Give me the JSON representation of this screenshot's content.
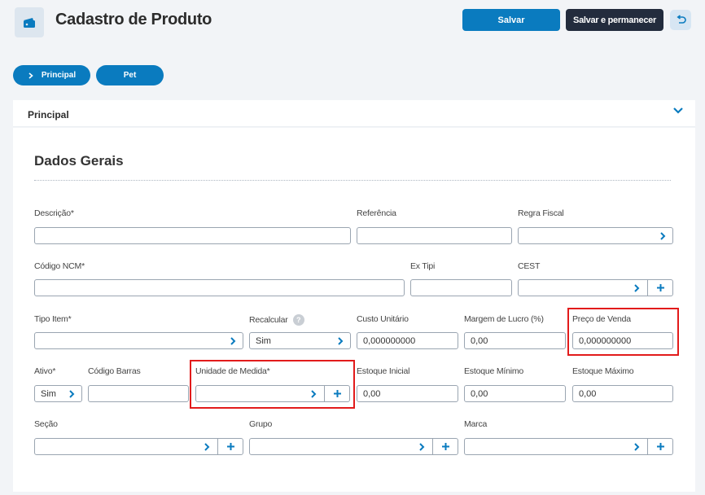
{
  "header": {
    "title": "Cadastro de Produto",
    "save_label": "Salvar",
    "save_stay_label": "Salvar e permanecer",
    "icon": "wallet-icon",
    "back_icon": "undo-icon"
  },
  "tabs": [
    {
      "label": "Principal",
      "active": true
    },
    {
      "label": "Pet",
      "active": false
    }
  ],
  "section": {
    "label": "Principal",
    "title": "Dados Gerais"
  },
  "fields": {
    "descricao": {
      "label": "Descrição*",
      "value": ""
    },
    "referencia": {
      "label": "Referência",
      "value": ""
    },
    "regra_fiscal": {
      "label": "Regra Fiscal",
      "value": ""
    },
    "codigo_ncm": {
      "label": "Código NCM*",
      "value": ""
    },
    "ex_tipi": {
      "label": "Ex Tipi",
      "value": ""
    },
    "cest": {
      "label": "CEST",
      "value": ""
    },
    "tipo_item": {
      "label": "Tipo Item*",
      "value": ""
    },
    "recalcular": {
      "label": "Recalcular",
      "value": "Sim"
    },
    "custo_unitario": {
      "label": "Custo Unitário",
      "value": "0,000000000"
    },
    "margem_lucro": {
      "label": "Margem de Lucro (%)",
      "value": "0,00"
    },
    "preco_venda": {
      "label": "Preço de Venda",
      "value": "0,000000000"
    },
    "ativo": {
      "label": "Ativo*",
      "value": "Sim"
    },
    "codigo_barras": {
      "label": "Código Barras",
      "value": ""
    },
    "unidade_medida": {
      "label": "Unidade de Medida*",
      "value": ""
    },
    "estoque_inicial": {
      "label": "Estoque Inicial",
      "value": "0,00"
    },
    "estoque_minimo": {
      "label": "Estoque Mínimo",
      "value": "0,00"
    },
    "estoque_maximo": {
      "label": "Estoque Máximo",
      "value": "0,00"
    },
    "secao": {
      "label": "Seção",
      "value": ""
    },
    "grupo": {
      "label": "Grupo",
      "value": ""
    },
    "marca": {
      "label": "Marca",
      "value": ""
    }
  },
  "colors": {
    "primary": "#0a7bbf",
    "dark_button": "#232c3d",
    "highlight_red": "#e21b1b"
  }
}
